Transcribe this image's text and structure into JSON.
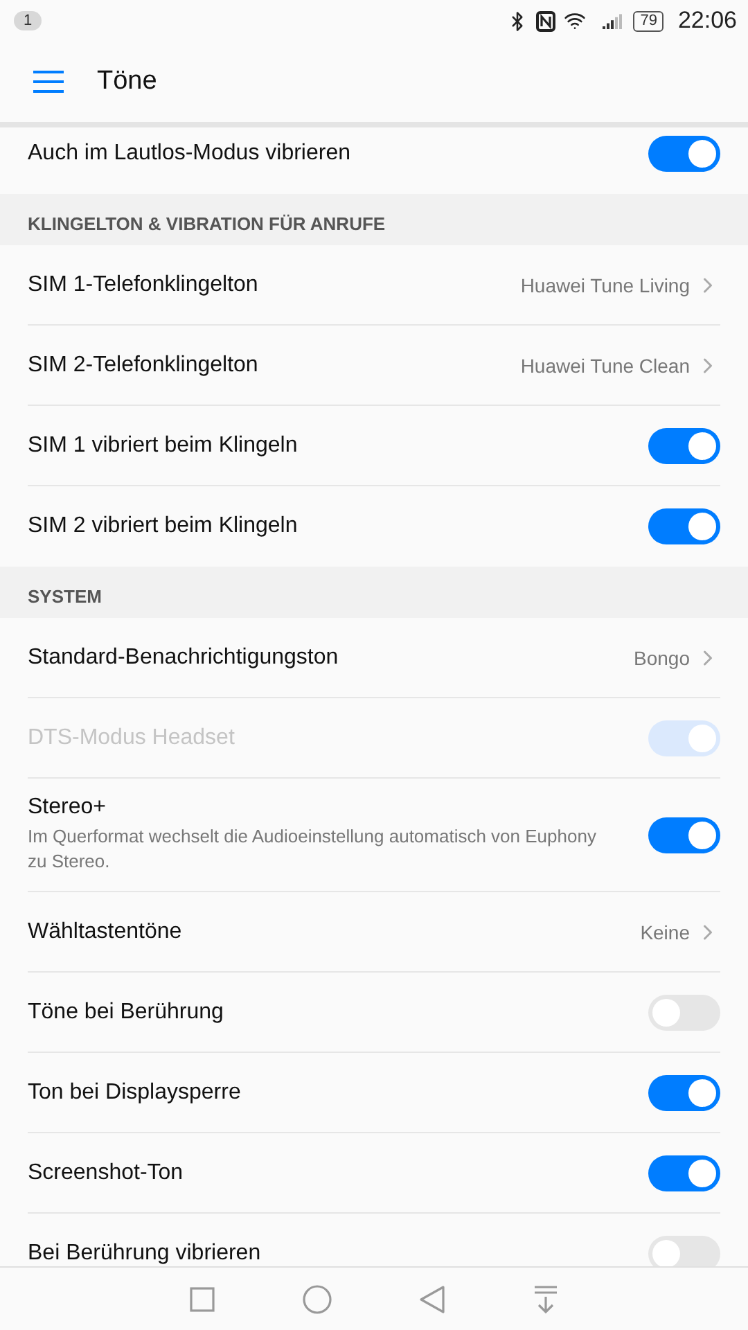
{
  "status_bar": {
    "notification_count": "1",
    "battery": "79",
    "time": "22:06"
  },
  "header": {
    "title": "Töne"
  },
  "items": [
    {
      "kind": "toggle",
      "label": "Auch im Lautlos-Modus vibrieren",
      "on": true,
      "disabled": false
    },
    {
      "kind": "section",
      "label": "KLINGELTON & VIBRATION FÜR ANRUFE"
    },
    {
      "kind": "link",
      "label": "SIM 1-Telefonklingelton",
      "value": "Huawei Tune Living"
    },
    {
      "kind": "link",
      "label": "SIM 2-Telefonklingelton",
      "value": "Huawei Tune Clean"
    },
    {
      "kind": "toggle",
      "label": "SIM 1 vibriert beim Klingeln",
      "on": true,
      "disabled": false
    },
    {
      "kind": "toggle",
      "label": "SIM 2 vibriert beim Klingeln",
      "on": true,
      "disabled": false
    },
    {
      "kind": "section",
      "label": "SYSTEM"
    },
    {
      "kind": "link",
      "label": "Standard-Benachrichtigungston",
      "value": "Bongo"
    },
    {
      "kind": "toggle",
      "label": "DTS-Modus Headset",
      "on": true,
      "disabled": true
    },
    {
      "kind": "toggle",
      "label": "Stereo+",
      "description": "Im Querformat wechselt die Audioeinstellung automatisch von Euphony zu Stereo.",
      "on": true,
      "disabled": false
    },
    {
      "kind": "link",
      "label": "Wähltastentöne",
      "value": "Keine"
    },
    {
      "kind": "toggle",
      "label": "Töne bei Berührung",
      "on": false,
      "disabled": false
    },
    {
      "kind": "toggle",
      "label": "Ton bei Displaysperre",
      "on": true,
      "disabled": false
    },
    {
      "kind": "toggle",
      "label": "Screenshot-Ton",
      "on": true,
      "disabled": false
    },
    {
      "kind": "toggle",
      "label": "Bei Berührung vibrieren",
      "on": false,
      "disabled": false
    }
  ]
}
